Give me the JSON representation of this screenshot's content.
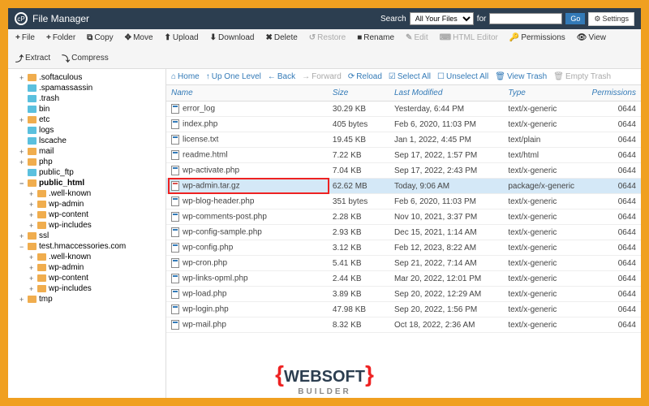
{
  "header": {
    "title": "File Manager",
    "search_label": "Search",
    "search_scope": "All Your Files",
    "for_label": "for",
    "search_value": "",
    "go_label": "Go",
    "settings_label": "Settings"
  },
  "toolbar": {
    "file": "File",
    "folder": "Folder",
    "copy": "Copy",
    "move": "Move",
    "upload": "Upload",
    "download": "Download",
    "delete": "Delete",
    "restore": "Restore",
    "rename": "Rename",
    "edit": "Edit",
    "html_editor": "HTML Editor",
    "permissions": "Permissions",
    "view": "View",
    "extract": "Extract",
    "compress": "Compress"
  },
  "nav": {
    "home": "Home",
    "up": "Up One Level",
    "back": "Back",
    "forward": "Forward",
    "reload": "Reload",
    "select_all": "Select All",
    "unselect_all": "Unselect All",
    "view_trash": "View Trash",
    "empty_trash": "Empty Trash"
  },
  "columns": {
    "name": "Name",
    "size": "Size",
    "modified": "Last Modified",
    "type": "Type",
    "perms": "Permissions"
  },
  "tree": [
    {
      "label": ".softaculous",
      "toggle": "+",
      "ind": 1,
      "orange": true
    },
    {
      "label": ".spamassassin",
      "toggle": "",
      "ind": 1
    },
    {
      "label": ".trash",
      "toggle": "",
      "ind": 1
    },
    {
      "label": "bin",
      "toggle": "",
      "ind": 1
    },
    {
      "label": "etc",
      "toggle": "+",
      "ind": 1,
      "orange": true
    },
    {
      "label": "logs",
      "toggle": "",
      "ind": 1
    },
    {
      "label": "lscache",
      "toggle": "",
      "ind": 1
    },
    {
      "label": "mail",
      "toggle": "+",
      "ind": 1,
      "orange": true
    },
    {
      "label": "php",
      "toggle": "+",
      "ind": 1,
      "orange": true
    },
    {
      "label": "public_ftp",
      "toggle": "",
      "ind": 1
    },
    {
      "label": "public_html",
      "toggle": "−",
      "ind": 1,
      "orange": true,
      "bold": true
    },
    {
      "label": ".well-known",
      "toggle": "+",
      "ind": 2,
      "orange": true
    },
    {
      "label": "wp-admin",
      "toggle": "+",
      "ind": 2,
      "orange": true
    },
    {
      "label": "wp-content",
      "toggle": "+",
      "ind": 2,
      "orange": true
    },
    {
      "label": "wp-includes",
      "toggle": "+",
      "ind": 2,
      "orange": true
    },
    {
      "label": "ssl",
      "toggle": "+",
      "ind": 1,
      "orange": true
    },
    {
      "label": "test.hmaccessories.com",
      "toggle": "−",
      "ind": 1,
      "orange": true
    },
    {
      "label": ".well-known",
      "toggle": "+",
      "ind": 2,
      "orange": true
    },
    {
      "label": "wp-admin",
      "toggle": "+",
      "ind": 2,
      "orange": true
    },
    {
      "label": "wp-content",
      "toggle": "+",
      "ind": 2,
      "orange": true
    },
    {
      "label": "wp-includes",
      "toggle": "+",
      "ind": 2,
      "orange": true
    },
    {
      "label": "tmp",
      "toggle": "+",
      "ind": 1,
      "orange": true
    }
  ],
  "files": [
    {
      "name": "error_log",
      "size": "30.29 KB",
      "modified": "Yesterday, 6:44 PM",
      "type": "text/x-generic",
      "perms": "0644"
    },
    {
      "name": "index.php",
      "size": "405 bytes",
      "modified": "Feb 6, 2020, 11:03 PM",
      "type": "text/x-generic",
      "perms": "0644"
    },
    {
      "name": "license.txt",
      "size": "19.45 KB",
      "modified": "Jan 1, 2022, 4:45 PM",
      "type": "text/plain",
      "perms": "0644"
    },
    {
      "name": "readme.html",
      "size": "7.22 KB",
      "modified": "Sep 17, 2022, 1:57 PM",
      "type": "text/html",
      "perms": "0644"
    },
    {
      "name": "wp-activate.php",
      "size": "7.04 KB",
      "modified": "Sep 17, 2022, 2:43 PM",
      "type": "text/x-generic",
      "perms": "0644"
    },
    {
      "name": "wp-admin.tar.gz",
      "size": "62.62 MB",
      "modified": "Today, 9:06 AM",
      "type": "package/x-generic",
      "perms": "0644",
      "highlight": true
    },
    {
      "name": "wp-blog-header.php",
      "size": "351 bytes",
      "modified": "Feb 6, 2020, 11:03 PM",
      "type": "text/x-generic",
      "perms": "0644"
    },
    {
      "name": "wp-comments-post.php",
      "size": "2.28 KB",
      "modified": "Nov 10, 2021, 3:37 PM",
      "type": "text/x-generic",
      "perms": "0644"
    },
    {
      "name": "wp-config-sample.php",
      "size": "2.93 KB",
      "modified": "Dec 15, 2021, 1:14 AM",
      "type": "text/x-generic",
      "perms": "0644"
    },
    {
      "name": "wp-config.php",
      "size": "3.12 KB",
      "modified": "Feb 12, 2023, 8:22 AM",
      "type": "text/x-generic",
      "perms": "0644"
    },
    {
      "name": "wp-cron.php",
      "size": "5.41 KB",
      "modified": "Sep 21, 2022, 7:14 AM",
      "type": "text/x-generic",
      "perms": "0644"
    },
    {
      "name": "wp-links-opml.php",
      "size": "2.44 KB",
      "modified": "Mar 20, 2022, 12:01 PM",
      "type": "text/x-generic",
      "perms": "0644"
    },
    {
      "name": "wp-load.php",
      "size": "3.89 KB",
      "modified": "Sep 20, 2022, 12:29 AM",
      "type": "text/x-generic",
      "perms": "0644"
    },
    {
      "name": "wp-login.php",
      "size": "47.98 KB",
      "modified": "Sep 20, 2022, 1:56 PM",
      "type": "text/x-generic",
      "perms": "0644"
    },
    {
      "name": "wp-mail.php",
      "size": "8.32 KB",
      "modified": "Oct 18, 2022, 2:36 AM",
      "type": "text/x-generic",
      "perms": "0644"
    }
  ],
  "watermark": {
    "main": "WEBSOFT",
    "sub": "BUILDER"
  }
}
